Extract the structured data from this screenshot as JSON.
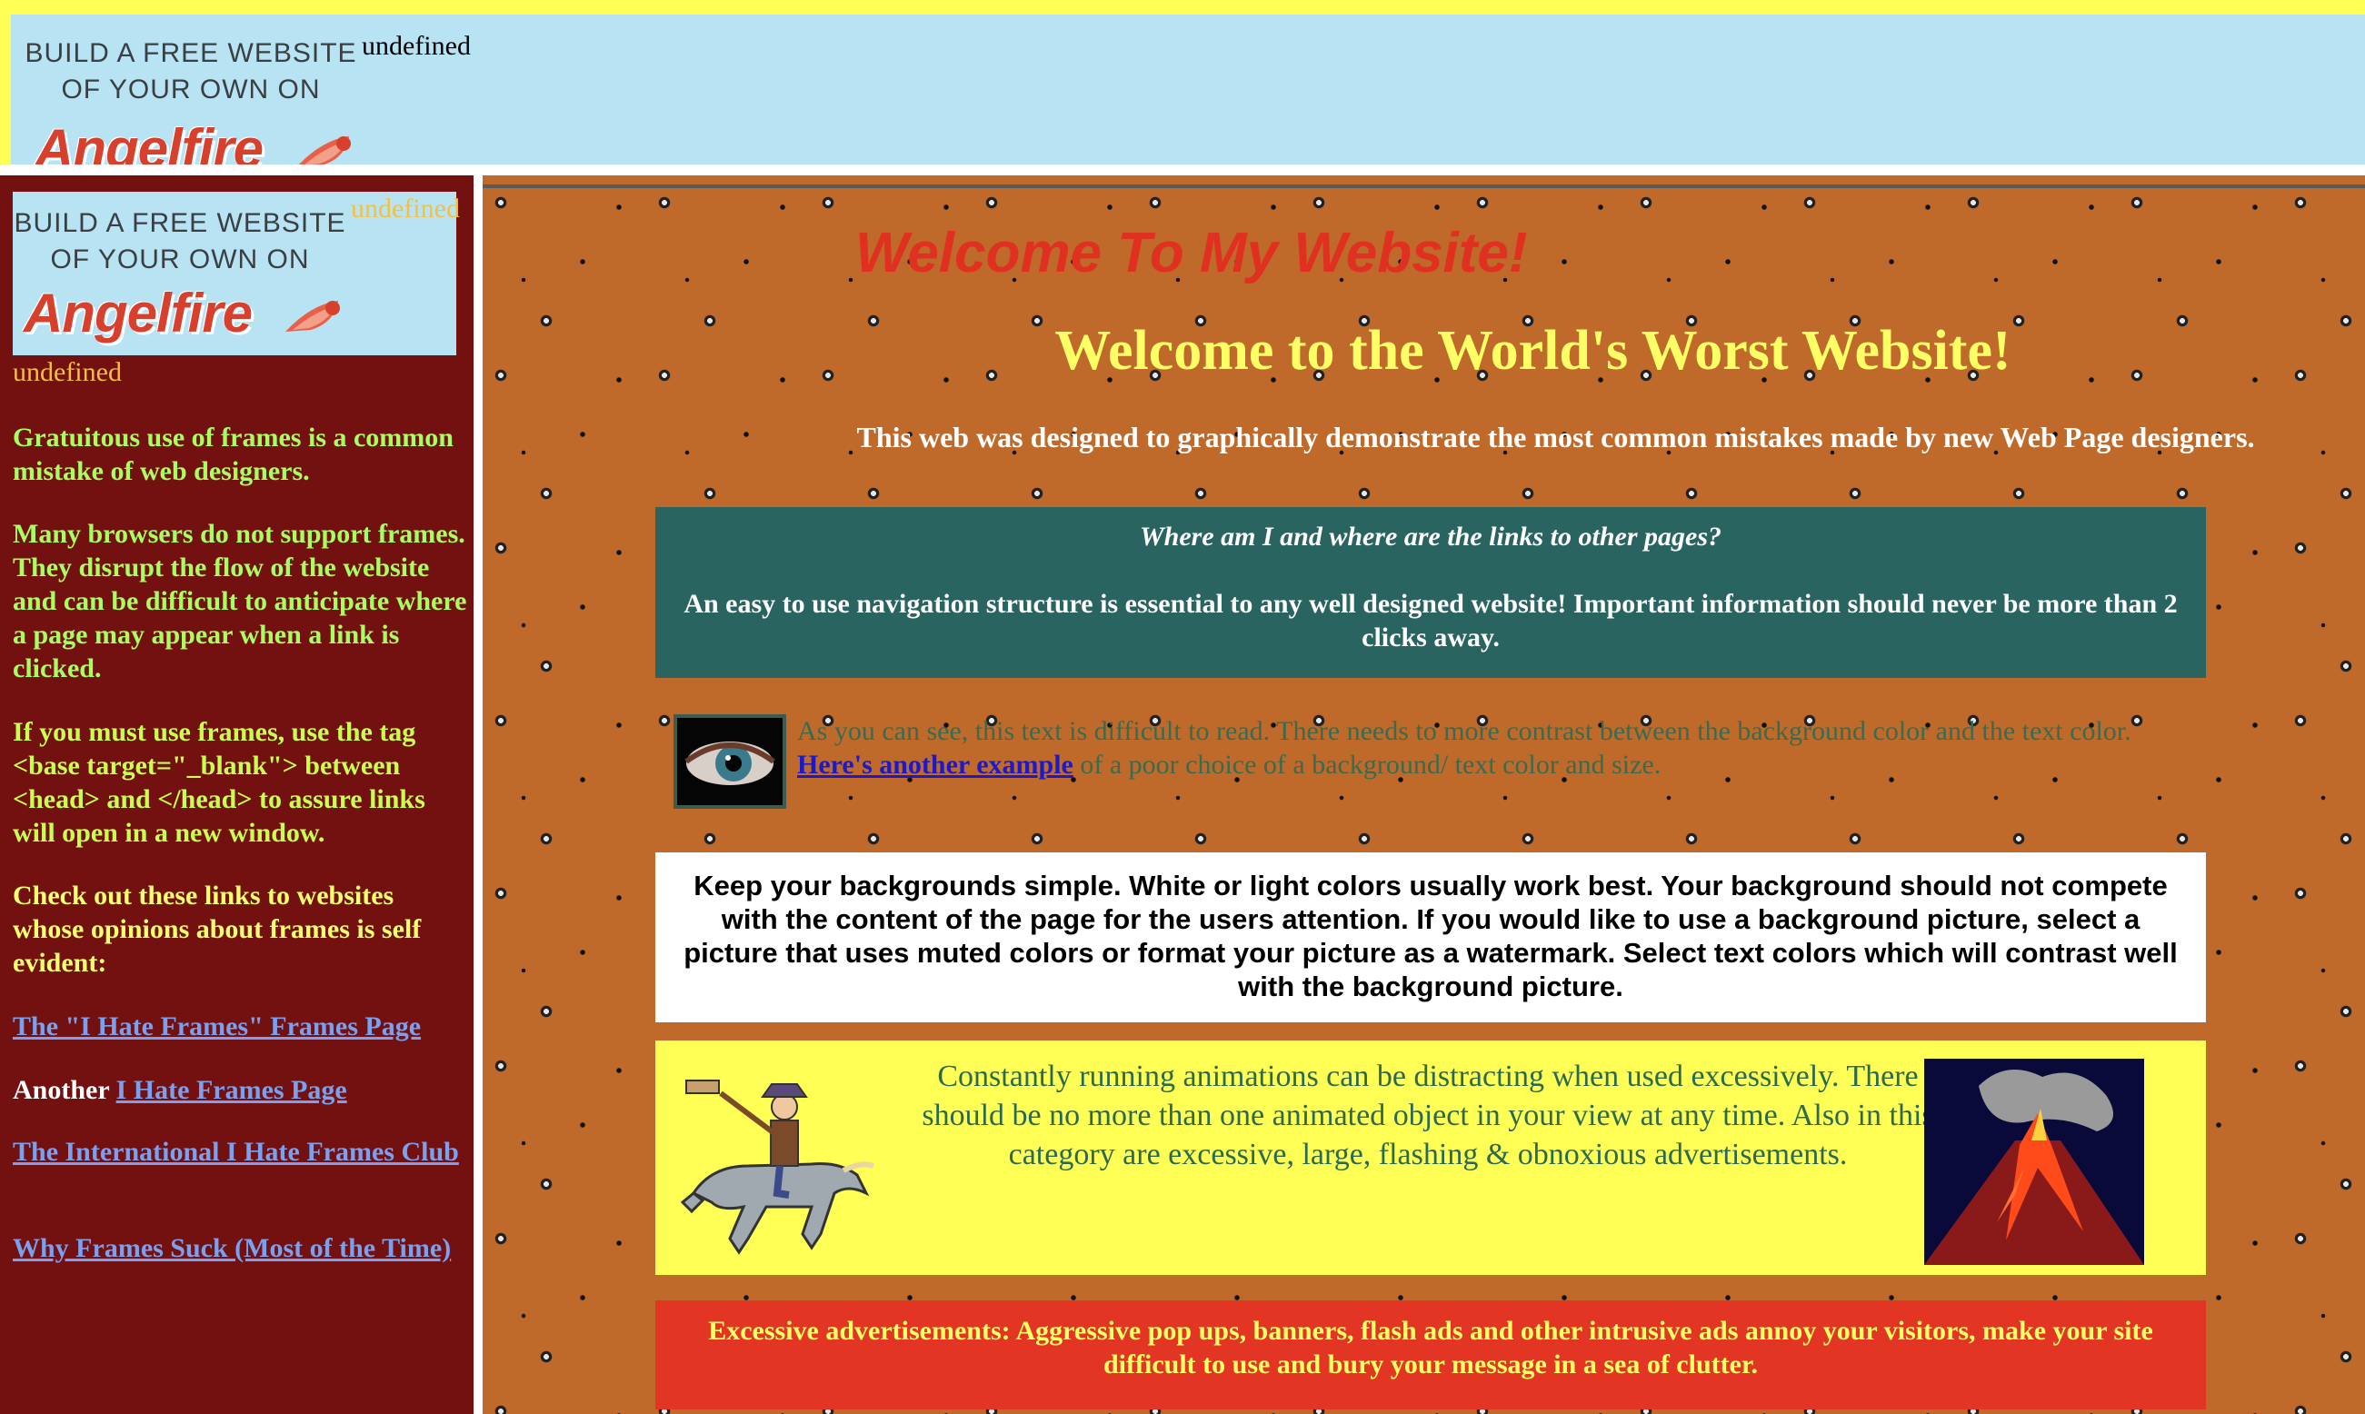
{
  "top_frame": {
    "ad": {
      "line1": "BUILD A FREE WEBSITE",
      "line2": "OF YOUR OWN ON",
      "brand": "Angelfire"
    },
    "undefined_text": "undefined"
  },
  "left_frame": {
    "ad": {
      "line1": "BUILD A FREE WEBSITE",
      "line2": "OF YOUR OWN ON",
      "brand": "Angelfire"
    },
    "undefined_1": "undefined",
    "undefined_2": "undefined",
    "para1": "Gratuitous use of frames is a common mistake of web designers.",
    "para2": "Many browsers do not support frames. They disrupt the flow of the website and can be difficult to anticipate where a page may appear when a link is clicked.",
    "para3": "If you must use frames, use the tag <base target=\"_blank\"> between <head> and </head> to assure links will open in a new window.",
    "para4": "Check out these links to websites whose opinions about frames is self evident:",
    "link1": "The \"I Hate Frames\" Frames Page",
    "another_prefix": "Another",
    "link2": "I Hate Frames Page",
    "link3": "The International I Hate Frames Club",
    "link4": "Why Frames Suck (Most of the Time)"
  },
  "main": {
    "welcome_red": "Welcome To My Website!",
    "welcome_yellow": "Welcome to the World's Worst Website!",
    "subtitle": "This web was designed to graphically demonstrate the most common mistakes made by new Web Page designers.",
    "nav_box": {
      "question": "Where am I and where are the links to other pages?",
      "body": "An easy to use navigation structure is essential to any well designed website! Important information should never be more than 2 clicks away."
    },
    "contrast": {
      "text_before": "As you can see, this text is difficult to read. There needs to more contrast between the background color and the text color.",
      "link": "Here's another example",
      "text_after": "of a poor choice of a background/ text color and size."
    },
    "background_box": "Keep your backgrounds simple. White or light colors usually work best. Your background should not compete with the content of the page for the users attention. If you would like to use a background picture, select a picture that uses muted colors or format your picture as a watermark. Select text colors which will contrast well with the background picture.",
    "animation_box": "Constantly running animations can be distracting when used excessively. There should be no more than one animated object in your view at any time. Also in this category are excessive, large, flashing & obnoxious advertisements.",
    "ads_box": "Excessive advertisements: Aggressive pop ups, banners, flash ads and other intrusive ads annoy your visitors, make your site difficult to use and bury your message in a sea of clutter."
  },
  "colors": {
    "left_frame_bg": "#731111",
    "top_frame_bg": "#b7e3f3",
    "main_bg": "#bf6a2a",
    "teal_box": "#296460",
    "red_box": "#e33524",
    "yellow_box": "#ffff55"
  },
  "icons": [
    "angelfire-comet-icon",
    "eye-image",
    "cowboy-painter-image",
    "volcano-image"
  ]
}
